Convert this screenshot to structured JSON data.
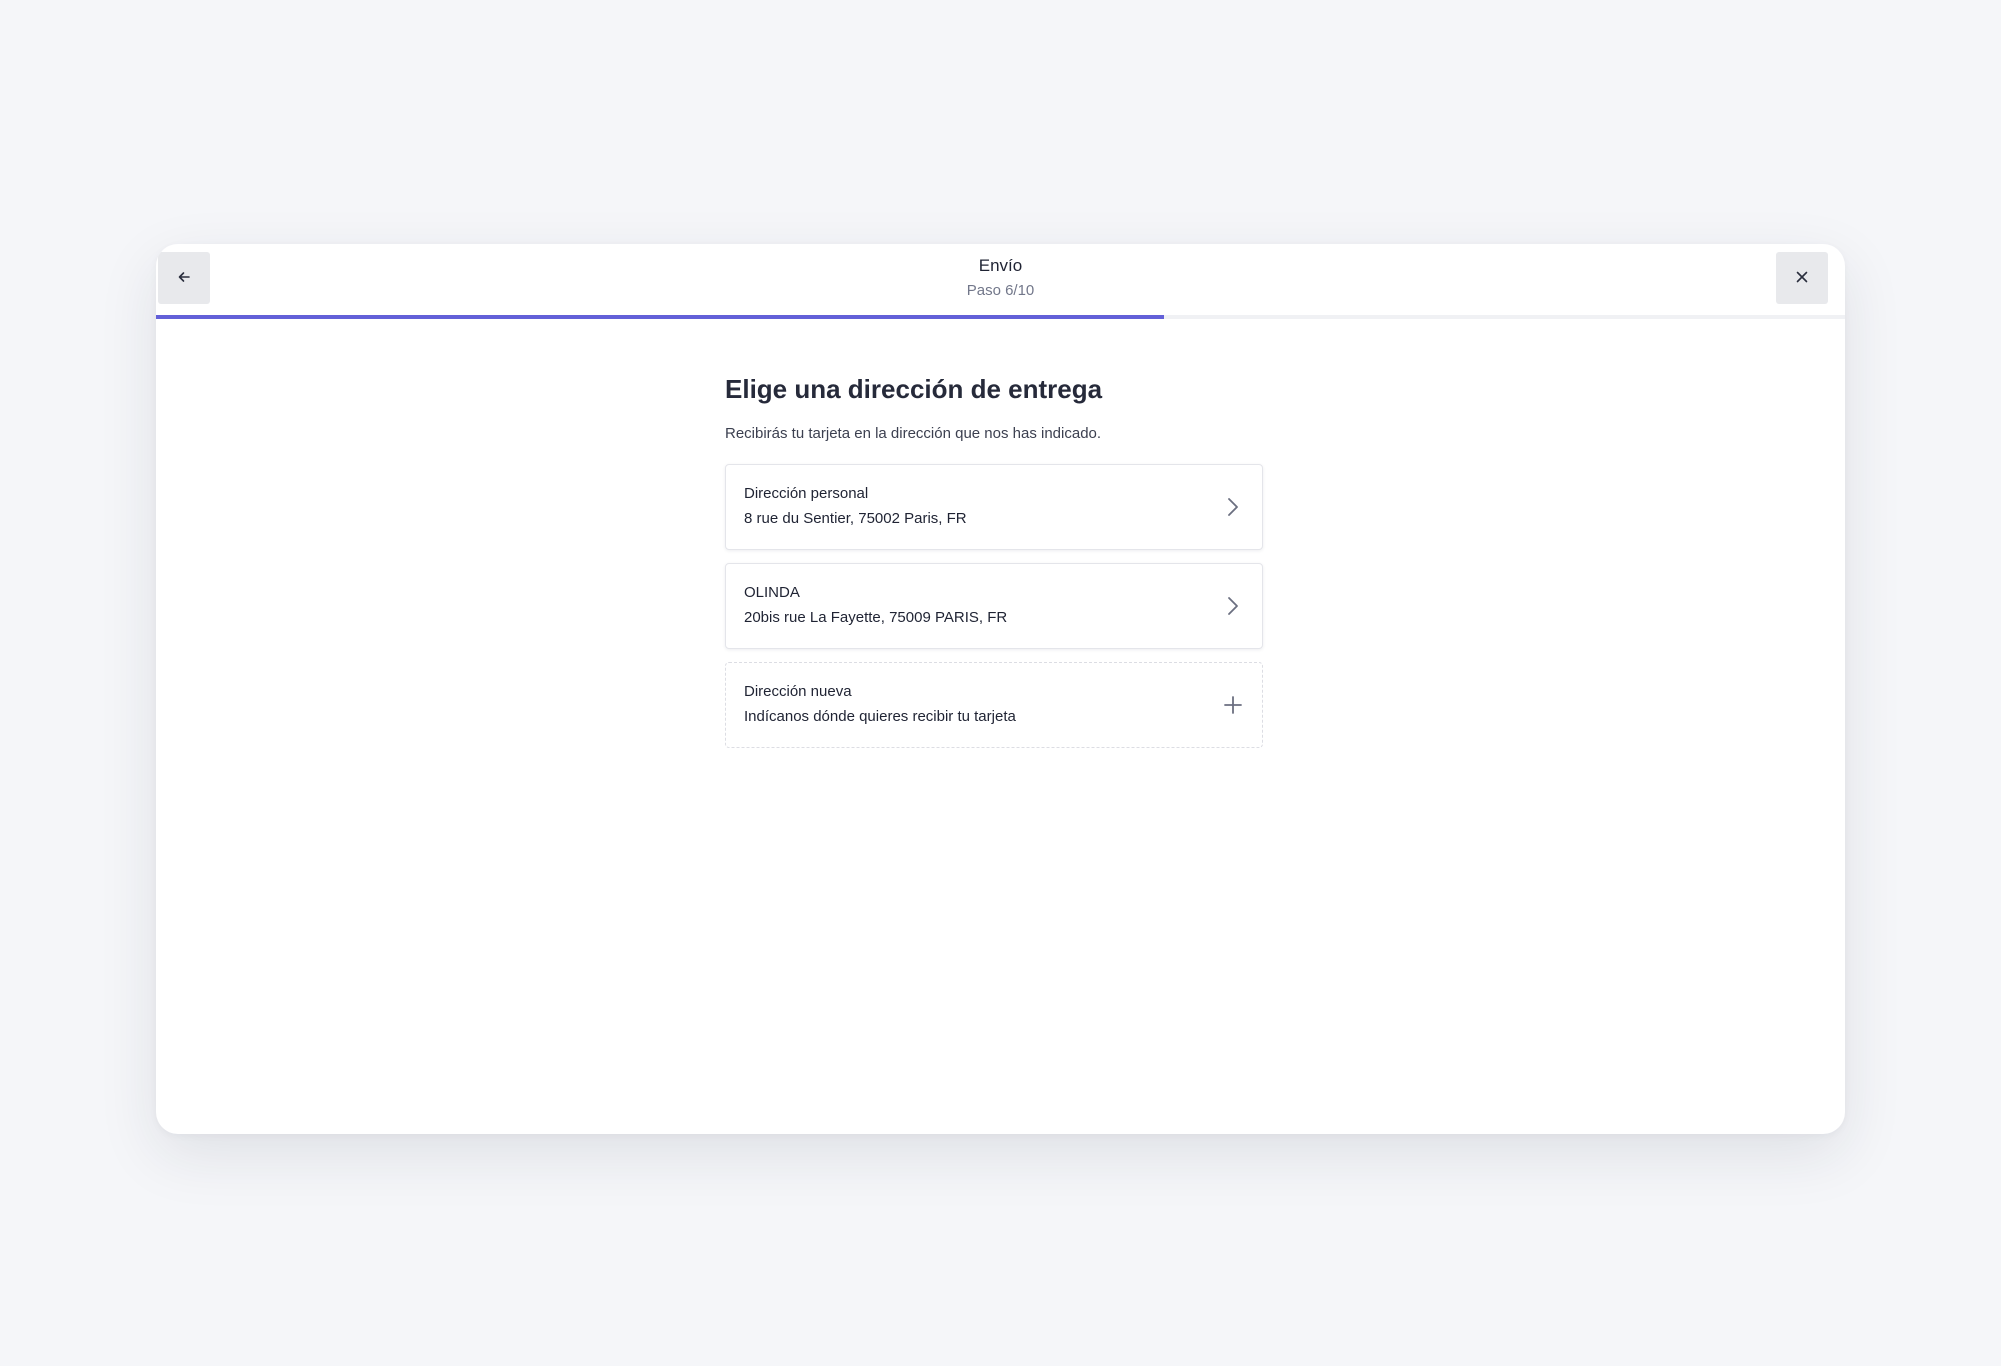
{
  "header": {
    "title": "Envío",
    "step": "Paso 6/10",
    "back_icon": "arrow-left-icon",
    "close_icon": "close-icon"
  },
  "progress": {
    "current": 6,
    "total": 10,
    "fraction": 0.597,
    "color": "#6360d8"
  },
  "main": {
    "title": "Elige una dirección de entrega",
    "subtitle": "Recibirás tu tarjeta en la dirección que nos has indicado.",
    "addresses": [
      {
        "title": "Dirección personal",
        "line": "8 rue du Sentier, 75002 Paris, FR",
        "icon": "chevron-right-icon"
      },
      {
        "title": "OLINDA",
        "line": "20bis rue La Fayette, 75009 PARIS, FR",
        "icon": "chevron-right-icon"
      }
    ],
    "new_address": {
      "title": "Dirección nueva",
      "line": "Indícanos dónde quieres recibir tu tarjeta",
      "icon": "plus-icon"
    }
  }
}
